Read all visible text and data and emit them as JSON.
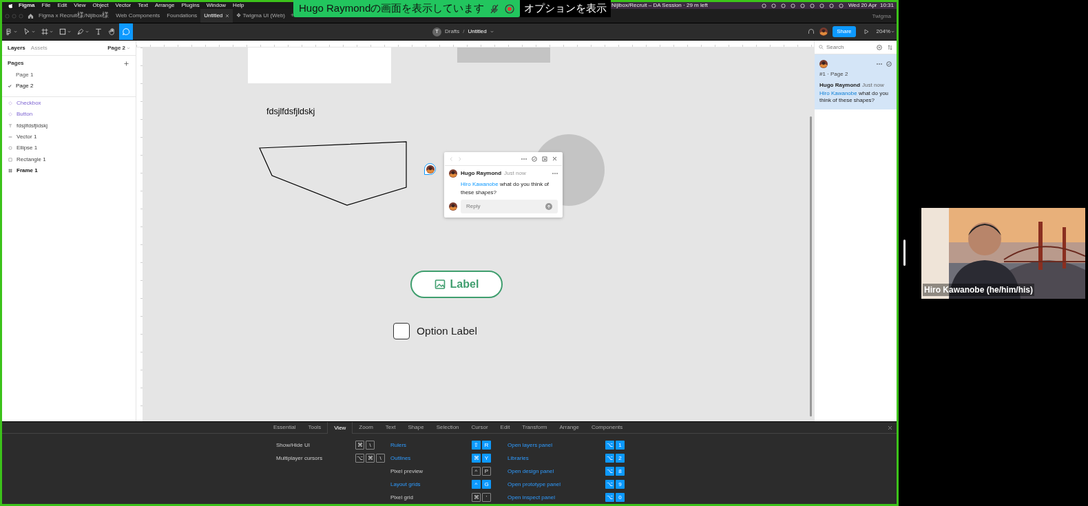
{
  "screen_share_banner": {
    "text": "Hugo Raymondの画面を表示しています",
    "options": "オプションを表示"
  },
  "menu_bar": {
    "items": [
      "Figma",
      "File",
      "Edit",
      "View",
      "Object",
      "Vector",
      "Text",
      "Arrange",
      "Plugins",
      "Window",
      "Help"
    ],
    "session": "Nijibox/Recruit – DA Session · 29 m left",
    "clock": "Wed 20 Apr  10:31"
  },
  "tabs": [
    {
      "label": "Figma x Recruit様/Nijibox様",
      "selected": false
    },
    {
      "label": "Web Components",
      "selected": false
    },
    {
      "label": "Foundations",
      "selected": false
    },
    {
      "label": "Untitled",
      "selected": true
    },
    {
      "label": "❖ Twigma UI (Web)",
      "selected": false
    }
  ],
  "new_tab": "+",
  "workspace": "Twigma",
  "toolbar": {
    "tools": [
      {
        "kind": "menu",
        "dropdown": true,
        "selected": false
      },
      {
        "kind": "move",
        "dropdown": true,
        "selected": false
      },
      {
        "kind": "frame",
        "dropdown": true,
        "selected": false
      },
      {
        "kind": "rectangle",
        "dropdown": true,
        "selected": false
      },
      {
        "kind": "pen",
        "dropdown": true,
        "selected": false
      },
      {
        "kind": "text",
        "dropdown": false,
        "selected": false
      },
      {
        "kind": "hand",
        "dropdown": false,
        "selected": false
      },
      {
        "kind": "comment",
        "dropdown": false,
        "selected": true
      }
    ],
    "team_initial": "T",
    "folder": "Drafts",
    "separator": "/",
    "file": "Untitled",
    "share": "Share",
    "zoom": "204%"
  },
  "left_panel": {
    "tabs": [
      {
        "label": "Layers",
        "selected": true
      },
      {
        "label": "Assets",
        "selected": false
      }
    ],
    "page_menu": "Page 2",
    "pages_heading": "Pages",
    "pages": [
      {
        "label": "Page 1",
        "selected": false
      },
      {
        "label": "Page 2",
        "selected": true
      }
    ],
    "layers": [
      {
        "kind": "component",
        "label": "Checkbox"
      },
      {
        "kind": "component",
        "label": "Button"
      },
      {
        "kind": "text",
        "label": "fdsjlfdsfjldskj"
      },
      {
        "kind": "vector",
        "label": "Vector 1"
      },
      {
        "kind": "ellipse",
        "label": "Ellipse 1"
      },
      {
        "kind": "rectangle",
        "label": "Rectangle 1"
      },
      {
        "kind": "frame",
        "label": "Frame 1"
      }
    ]
  },
  "canvas": {
    "text": "fdsjlfdsfjldskj",
    "button_label": "Label",
    "checkbox": {
      "label": "Option Label",
      "checked": false
    },
    "comment_popup": {
      "author": "Hugo Raymond",
      "time": "Just now",
      "mention": "Hiro Kawanobe",
      "message": "what do you think of these shapes?",
      "reply_placeholder": "Reply"
    }
  },
  "right_panel": {
    "search_placeholder": "Search",
    "comment": {
      "number": "#1 · Page 2",
      "author": "Hugo Raymond",
      "time": "Just now",
      "mention": "Hiro Kawanobe",
      "message": "what do you think of these shapes?"
    }
  },
  "shortcuts": {
    "tabs": [
      {
        "label": "Essential",
        "selected": false
      },
      {
        "label": "Tools",
        "selected": false
      },
      {
        "label": "View",
        "selected": true
      },
      {
        "label": "Zoom",
        "selected": false
      },
      {
        "label": "Text",
        "selected": false
      },
      {
        "label": "Shape",
        "selected": false
      },
      {
        "label": "Selection",
        "selected": false
      },
      {
        "label": "Cursor",
        "selected": false
      },
      {
        "label": "Edit",
        "selected": false
      },
      {
        "label": "Transform",
        "selected": false
      },
      {
        "label": "Arrange",
        "selected": false
      },
      {
        "label": "Components",
        "selected": false
      }
    ],
    "columns": [
      [
        {
          "label": "Show/Hide UI",
          "keys": [
            "⌘",
            "\\"
          ],
          "on": false
        },
        {
          "label": "Multiplayer cursors",
          "keys": [
            "⌥",
            "⌘",
            "\\"
          ],
          "on": false
        }
      ],
      [
        {
          "label": "Rulers",
          "keys": [
            "⇧",
            "R"
          ],
          "on": true
        },
        {
          "label": "Outlines",
          "keys": [
            "⌘",
            "Y"
          ],
          "on": true
        },
        {
          "label": "Pixel preview",
          "keys": [
            "^",
            "P"
          ],
          "on": false
        },
        {
          "label": "Layout grids",
          "keys": [
            "^",
            "G"
          ],
          "on": true
        },
        {
          "label": "Pixel grid",
          "keys": [
            "⌘",
            "'"
          ],
          "on": false
        }
      ],
      [
        {
          "label": "Open layers panel",
          "keys": [
            "⌥",
            "1"
          ],
          "on": true
        },
        {
          "label": "Libraries",
          "keys": [
            "⌥",
            "2"
          ],
          "on": true
        },
        {
          "label": "Open design panel",
          "keys": [
            "⌥",
            "8"
          ],
          "on": true
        },
        {
          "label": "Open prototype panel",
          "keys": [
            "⌥",
            "9"
          ],
          "on": true
        },
        {
          "label": "Open inspect panel",
          "keys": [
            "⌥",
            "0"
          ],
          "on": true
        }
      ]
    ]
  },
  "video": {
    "participant": "Hiro Kawanobe (he/him/his)"
  }
}
